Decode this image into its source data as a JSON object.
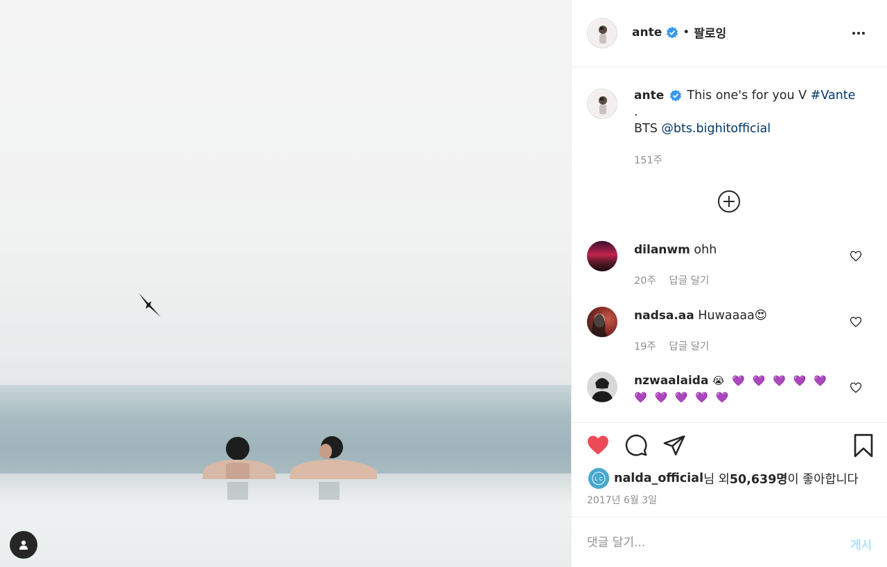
{
  "post": {
    "author": "ante",
    "follow_label": "팔로잉",
    "separator": "•"
  },
  "caption": {
    "username": "ante",
    "text": "This one's for you V",
    "hashtag": "#Vante",
    "line2": ".",
    "line3_prefix": "BTS",
    "mention": "@bts.bighitofficial",
    "time": "151주"
  },
  "comments": [
    {
      "username": "dilanwm",
      "text": "ohh",
      "time": "20주",
      "reply_label": "답글 달기"
    },
    {
      "username": "nadsa.aa",
      "text": "Huwaaaa😍",
      "time": "19주",
      "reply_label": "답글 달기"
    },
    {
      "username": "nzwaalaida",
      "text": "😭 💜 💜 💜 💜 💜",
      "text_line2": "💜 💜 💜 💜 💜"
    }
  ],
  "likes": {
    "user": "nalda_official",
    "mid": "님 외 ",
    "count": "50,639명",
    "suffix": "이 좋아합니다"
  },
  "date": "2017년 6월 3일",
  "comment_input": {
    "placeholder": "댓글 달기...",
    "post_label": "게시"
  },
  "colors": {
    "like_red": "#ed4956",
    "link_blue": "#00376b",
    "verified_blue": "#3897f0",
    "post_disabled": "#b2dffc",
    "muted": "#8e8e8e"
  },
  "icons": [
    "user-tag-icon",
    "verified-icon",
    "more-options-icon",
    "load-more-comments-icon",
    "heart-icon",
    "comment-icon",
    "share-icon",
    "bookmark-icon"
  ]
}
